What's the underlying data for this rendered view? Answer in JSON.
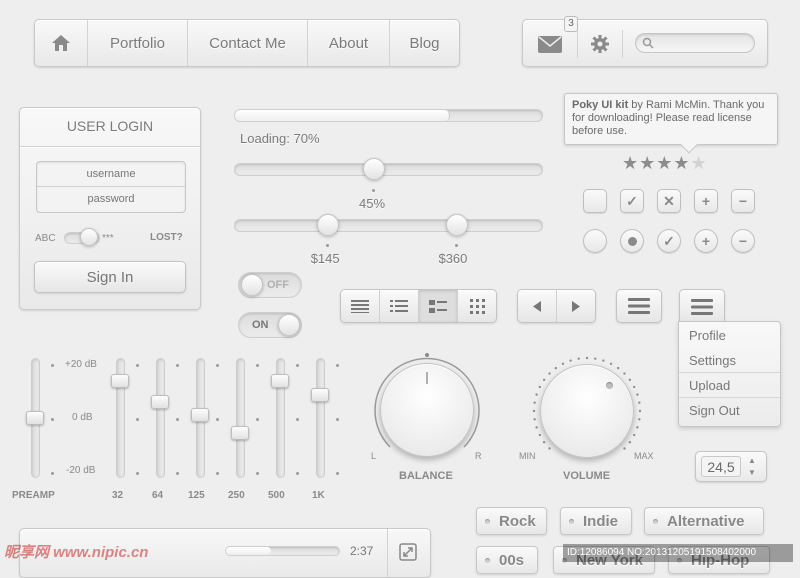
{
  "nav": {
    "items": [
      "Portfolio",
      "Contact Me",
      "About",
      "Blog"
    ]
  },
  "toolbar": {
    "mail_badge": "3",
    "search_placeholder": ""
  },
  "login": {
    "title": "USER LOGIN",
    "username_placeholder": "username",
    "password_placeholder": "password",
    "toggle_left": "ABC",
    "toggle_right": "***",
    "lost": "LOST?",
    "signin": "Sign In"
  },
  "progress": {
    "label": "Loading: 70%",
    "value": 0.7
  },
  "slider": {
    "value_label": "45%",
    "value": 0.45
  },
  "range": {
    "min_label": "$145",
    "max_label": "$360",
    "min": 0.3,
    "max": 0.72
  },
  "tooltip": {
    "brand": "Poky UI kit",
    "text": " by Rami McMin. Thank you for downloading! Please read license before use."
  },
  "rating": {
    "value": 4,
    "max": 5
  },
  "switches": {
    "off": "OFF",
    "on": "ON"
  },
  "dropdown": {
    "items": [
      "Profile",
      "Settings",
      "Upload",
      "Sign Out"
    ]
  },
  "equalizer": {
    "db_labels": [
      "+20 dB",
      "0 dB",
      "-20 dB"
    ],
    "preamp_label": "PREAMP",
    "bands": [
      {
        "label": "32",
        "level": 0.85
      },
      {
        "label": "64",
        "level": 0.65
      },
      {
        "label": "125",
        "level": 0.53
      },
      {
        "label": "250",
        "level": 0.36
      },
      {
        "label": "500",
        "level": 0.85
      },
      {
        "label": "1K",
        "level": 0.72
      }
    ],
    "preamp_level": 0.5
  },
  "balance": {
    "label": "BALANCE",
    "left": "L",
    "right": "R"
  },
  "volume": {
    "label": "VOLUME",
    "min": "MIN",
    "max": "MAX"
  },
  "stepper": {
    "value": "24,5"
  },
  "player": {
    "time": "2:37",
    "progress": 0.4
  },
  "tags": [
    "Rock",
    "Indie",
    "Alternative",
    "00s",
    "New York",
    "Hip-Hop"
  ],
  "watermark": {
    "left": "昵享网 www.nipic.cn",
    "right": "ID:12086094 NO:20131205191508402000"
  }
}
